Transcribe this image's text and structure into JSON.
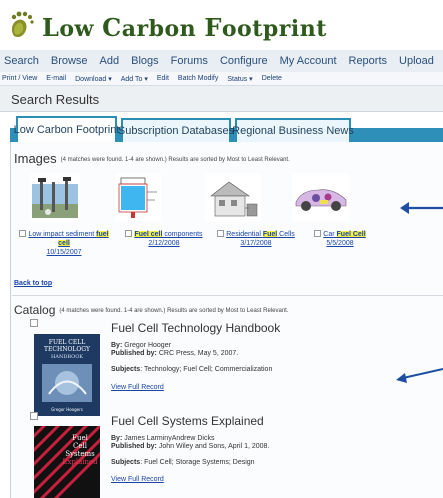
{
  "brand": {
    "name_part1": "L",
    "name_part2": "ow ",
    "name_part3": "C",
    "name_part4": "arbon ",
    "name_part5": "F",
    "name_part6": "ootprint"
  },
  "main_menu": [
    "Search",
    "Browse",
    "Add",
    "Blogs",
    "Forums",
    "Configure",
    "My Account",
    "Reports",
    "Upload"
  ],
  "sub_menu": [
    "Print / View",
    "E-mail",
    "Download ▾",
    "Add To ▾",
    "Edit",
    "Batch Modify",
    "Status ▾",
    "Delete"
  ],
  "page_title": "Search Results",
  "tabs": [
    "Low Carbon Footprint",
    "Subscription Databases",
    "Regional Business News"
  ],
  "images_section": {
    "title": "Images",
    "note": "(4 matches were found. 1-4 are shown.) Results are sorted by Most to Least Relevant.",
    "items": [
      {
        "pre": "Low impact sediment ",
        "hl": "fuel cell",
        "post": "",
        "date": "10/15/2007"
      },
      {
        "pre": "",
        "hl": "Fuel cell",
        "post": " components",
        "date": "2/12/2008"
      },
      {
        "pre": "Residential ",
        "hl": "Fuel",
        "post": " Cells",
        "date": "3/17/2008"
      },
      {
        "pre": "Car ",
        "hl": "Fuel Cell",
        "post": "",
        "date": "5/5/2008"
      }
    ]
  },
  "back_to_top": "Back to top",
  "catalog_section": {
    "title": "Catalog",
    "note": "(4 matches were found. 1-4 are shown.) Results are sorted by Most to Least Relevant."
  },
  "records": [
    {
      "title": "Fuel Cell Technology Handbook",
      "by_label": "By:",
      "by": "Gregor Hooger",
      "pub_label": "Published by:",
      "pub": "CRC Press, May 5, 2007.",
      "subj_label": "Subjects",
      "subjects": ": Technology; Fuel Cell; Commercialization",
      "link": "View Full Record",
      "cover_text": [
        "FUEL CELL",
        "TECHNOLOGY",
        "HANDBOOK",
        "Gregor Hoogers"
      ]
    },
    {
      "title": "Fuel Cell Systems Explained",
      "by_label": "By:",
      "by": "James LarminyAndrew Dicks",
      "pub_label": "Published by:",
      "pub": "John Wiley and Sons, April 1, 2008.",
      "subj_label": "Subjects",
      "subjects": ": Fuel Cell; Storage Systems; Design",
      "link": "View Full Record",
      "cover_text": [
        "Fuel",
        "Cell",
        "Systems",
        "Explained"
      ]
    }
  ],
  "colors": {
    "brand_green": "#2f5a1d",
    "tab_blue": "#2e90b8",
    "arrow_blue": "#1f4fa3",
    "highlight": "#f6f046"
  }
}
